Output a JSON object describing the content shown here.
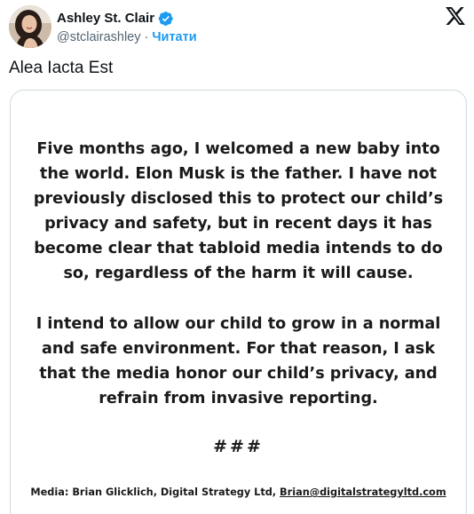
{
  "author": {
    "display_name": "Ashley St. Clair",
    "handle": "@stclairashley",
    "separator": "·",
    "follow_label": "Читати",
    "verified": true,
    "avatar_icon": "profile-photo"
  },
  "platform_icon": "x-logo-icon",
  "tweet": {
    "text": "Alea Iacta Est"
  },
  "media": {
    "paragraphs": [
      "Five months ago, I welcomed a new baby into the world. Elon Musk is the father. I have not previously disclosed this to protect our child’s privacy and safety, but in recent days it has become clear that tabloid media intends to do so, regardless of the harm it will cause.",
      "I intend to allow our child to grow in a normal and safe environment. For that reason, I ask that the media honor our child’s privacy, and refrain from invasive reporting."
    ],
    "end_marker": "###",
    "contact_prefix": "Media: Brian Glicklich, Digital Strategy Ltd, ",
    "contact_email": "Brian@digitalstrategyltd.com"
  },
  "colors": {
    "accent": "#1d9bf0",
    "text": "#0f1419",
    "muted": "#536471",
    "border": "#cfd9de"
  }
}
